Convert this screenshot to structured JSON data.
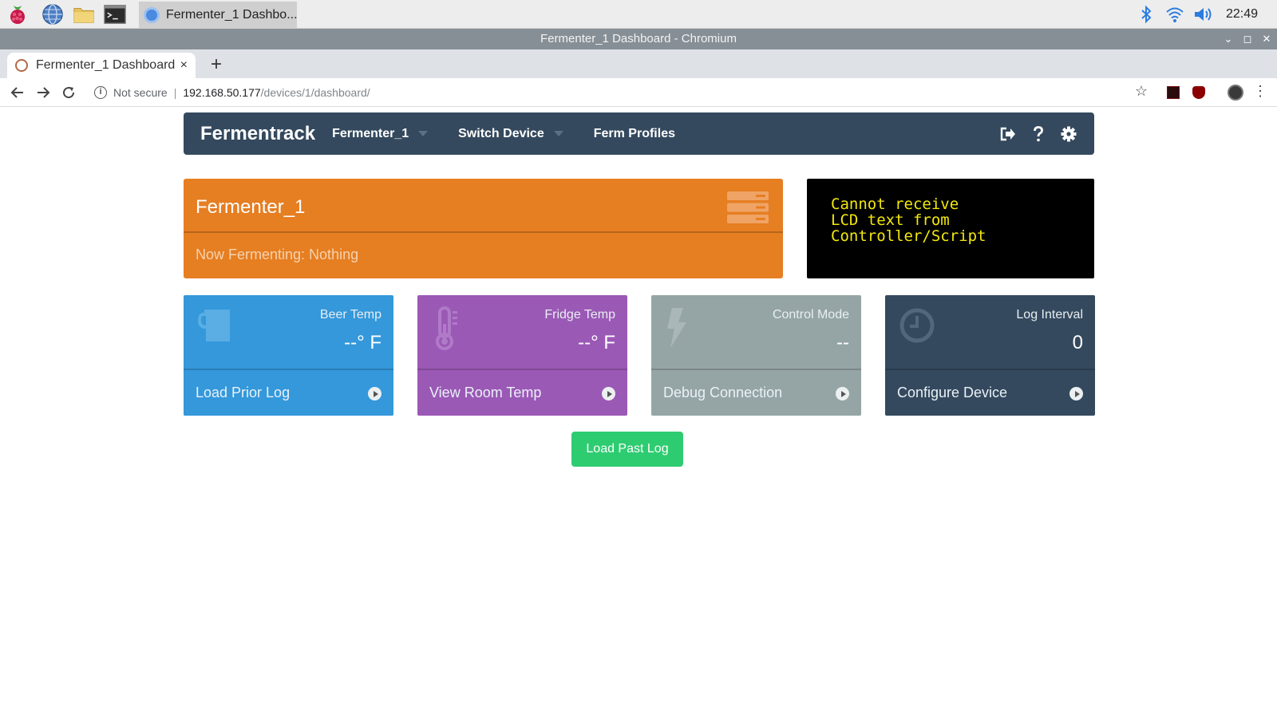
{
  "taskbar": {
    "active_task": "Fermenter_1 Dashbo...",
    "clock": "22:49"
  },
  "window": {
    "title": "Fermenter_1 Dashboard - Chromium"
  },
  "tab": {
    "title": "Fermenter_1 Dashboard",
    "close": "×",
    "new_tab": "+"
  },
  "omnibox": {
    "security_label": "Not secure",
    "separator": "|",
    "host": "192.168.50.177",
    "path": "/devices/1/dashboard/"
  },
  "navbar": {
    "brand": "Fermentrack",
    "device_menu": "Fermenter_1",
    "switch_device": "Switch Device",
    "ferm_profiles": "Ferm Profiles"
  },
  "device_panel": {
    "name": "Fermenter_1",
    "status": "Now Fermenting: Nothing",
    "accent": "#e67e22"
  },
  "lcd": {
    "lines": [
      "Cannot receive",
      "LCD text from",
      "Controller/Script"
    ],
    "text_color": "#f2e70e"
  },
  "stats": [
    {
      "label": "Beer Temp",
      "value": "--° F",
      "action": "Load Prior Log",
      "color": "#3498db",
      "icon": "beer-mug-icon"
    },
    {
      "label": "Fridge Temp",
      "value": "--° F",
      "action": "View Room Temp",
      "color": "#9b59b6",
      "icon": "thermometer-icon"
    },
    {
      "label": "Control Mode",
      "value": "--",
      "action": "Debug Connection",
      "color": "#95a5a6",
      "icon": "lightning-icon"
    },
    {
      "label": "Log Interval",
      "value": "0",
      "action": "Configure Device",
      "color": "#34495e",
      "icon": "clock-icon"
    }
  ],
  "load_past_log": "Load Past Log"
}
